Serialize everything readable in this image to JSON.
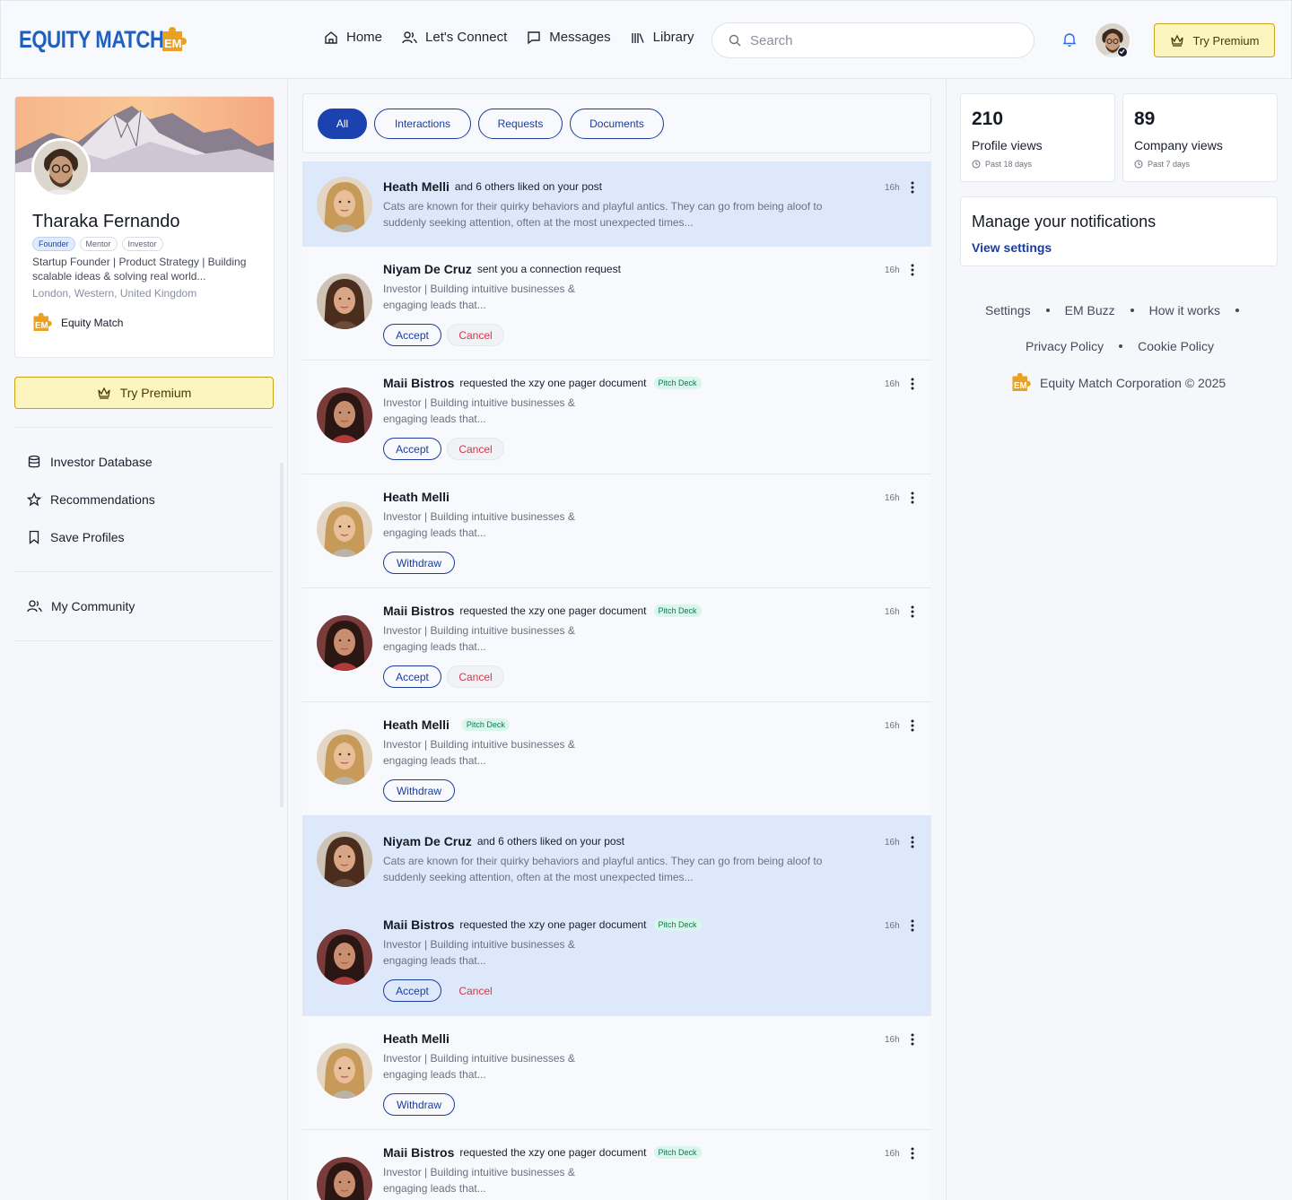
{
  "brand": {
    "name": "EQUITY MATCH",
    "mark": "EM"
  },
  "nav": {
    "items": [
      {
        "label": "Home",
        "icon": "home-icon"
      },
      {
        "label": "Let's Connect",
        "icon": "users-icon"
      },
      {
        "label": "Messages",
        "icon": "message-icon"
      },
      {
        "label": "Library",
        "icon": "library-icon"
      }
    ],
    "search_placeholder": "Search",
    "premium_label": "Try Premium"
  },
  "profile": {
    "name": "Tharaka Fernando",
    "badges": [
      "Founder",
      "Mentor",
      "Investor"
    ],
    "description": "Startup Founder | Product Strategy | Building scalable ideas & solving real world...",
    "location": "London, Western, United Kingdom",
    "company": "Equity Match"
  },
  "sidebar": {
    "premium_label": "Try Premium",
    "items": [
      {
        "label": "Investor Database",
        "icon": "database-icon"
      },
      {
        "label": "Recommendations",
        "icon": "star-icon"
      },
      {
        "label": "Save Profiles",
        "icon": "bookmark-icon"
      },
      {
        "label": "My Community",
        "icon": "community-icon"
      }
    ]
  },
  "filters": [
    "All",
    "Interactions",
    "Requests",
    "Documents"
  ],
  "active_filter": "All",
  "notifications": [
    {
      "name": "Heath Melli",
      "action": "and 6 others liked on your post",
      "tag": "",
      "sub": "Cats are known for their quirky behaviors and playful antics. They can go from being aloof to suddenly seeking attention, often at the most unexpected times...",
      "time": "16h",
      "kind": "like",
      "person": "heath"
    },
    {
      "name": "Niyam De Cruz",
      "action": "sent you a connection request",
      "tag": "",
      "sub": "Investor | Building intuitive businesses & engaging leads that...",
      "time": "16h",
      "kind": "request",
      "person": "niyam"
    },
    {
      "name": "Maii Bistros",
      "action": "requested the xzy one pager document",
      "tag": "Pitch Deck",
      "sub": "Investor | Building intuitive businesses & engaging leads that...",
      "time": "16h",
      "kind": "request",
      "person": "maii"
    },
    {
      "name": "Heath Melli",
      "action": "",
      "tag": "",
      "sub": "Investor | Building intuitive businesses & engaging leads that...",
      "time": "16h",
      "kind": "withdraw",
      "person": "heath"
    },
    {
      "name": "Maii Bistros",
      "action": "requested the xzy one pager document",
      "tag": "Pitch Deck",
      "sub": "Investor | Building intuitive businesses & engaging leads that...",
      "time": "16h",
      "kind": "request",
      "person": "maii"
    },
    {
      "name": "Heath Melli",
      "action": "",
      "tag": "Pitch Deck",
      "sub": "Investor | Building intuitive businesses & engaging leads that...",
      "time": "16h",
      "kind": "withdraw",
      "person": "heath"
    },
    {
      "name": "Niyam De Cruz",
      "action": "and 6 others liked on your post",
      "tag": "",
      "sub": "Cats are known for their quirky behaviors and playful antics. They can go from being aloof to suddenly seeking attention, often at the most unexpected times...",
      "time": "16h",
      "kind": "like",
      "person": "niyam"
    },
    {
      "name": "Maii Bistros",
      "action": "requested the xzy one pager document",
      "tag": "Pitch Deck",
      "sub": "Investor | Building intuitive businesses & engaging leads that...",
      "time": "16h",
      "kind": "request",
      "person": "maii"
    },
    {
      "name": "Heath Melli",
      "action": "",
      "tag": "",
      "sub": "Investor | Building intuitive businesses & engaging leads that...",
      "time": "16h",
      "kind": "withdraw",
      "person": "heath"
    },
    {
      "name": "Maii Bistros",
      "action": "requested the xzy one pager document",
      "tag": "Pitch Deck",
      "sub": "Investor | Building intuitive businesses & engaging leads that...",
      "time": "16h",
      "kind": "request",
      "person": "maii"
    }
  ],
  "buttons": {
    "accept": "Accept",
    "cancel": "Cancel",
    "withdraw": "Withdraw"
  },
  "stats": [
    {
      "value": "210",
      "label": "Profile views",
      "period": "Past 18 days"
    },
    {
      "value": "89",
      "label": "Company views",
      "period": "Past 7 days"
    }
  ],
  "notif_settings": {
    "title": "Manage your notifications",
    "link": "View settings"
  },
  "footer": {
    "row1": [
      "Settings",
      "EM Buzz",
      "How it works"
    ],
    "row2": [
      "Privacy Policy",
      "Cookie Policy"
    ],
    "copyright": "Equity Match Corporation © 2025"
  },
  "colors": {
    "primary": "#1c42b0",
    "brand": "#1f5fbf",
    "accent": "#e8a123",
    "highlight": "#dde9fb",
    "premium": "#fdf5bf",
    "danger": "#d4364a"
  }
}
